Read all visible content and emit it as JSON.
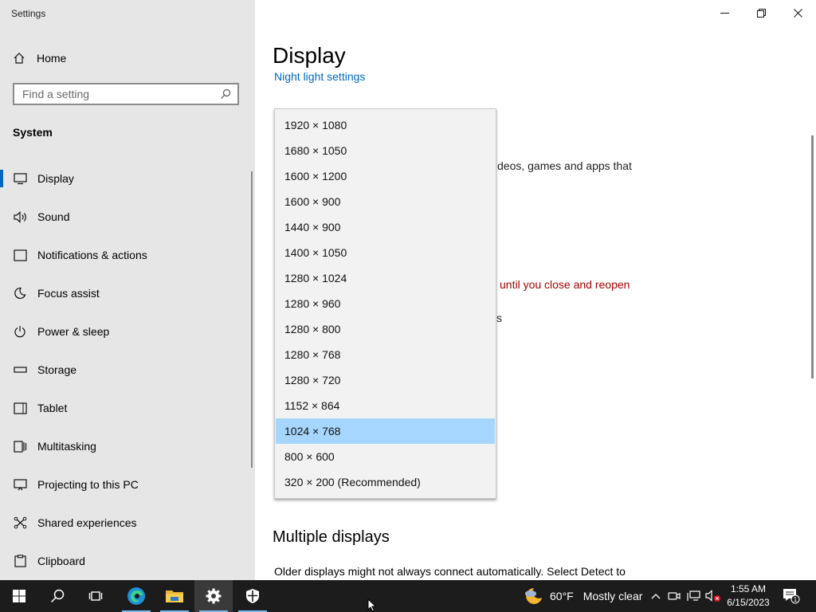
{
  "window": {
    "app_title": "Settings"
  },
  "sidebar": {
    "home_label": "Home",
    "search_placeholder": "Find a setting",
    "section_label": "System",
    "items": [
      {
        "label": "Display",
        "icon": "monitor-icon"
      },
      {
        "label": "Sound",
        "icon": "speaker-icon"
      },
      {
        "label": "Notifications & actions",
        "icon": "notification-icon"
      },
      {
        "label": "Focus assist",
        "icon": "moon-icon"
      },
      {
        "label": "Power & sleep",
        "icon": "power-icon"
      },
      {
        "label": "Storage",
        "icon": "storage-icon"
      },
      {
        "label": "Tablet",
        "icon": "tablet-icon"
      },
      {
        "label": "Multitasking",
        "icon": "multitasking-icon"
      },
      {
        "label": "Projecting to this PC",
        "icon": "projecting-icon"
      },
      {
        "label": "Shared experiences",
        "icon": "shared-experiences-icon"
      },
      {
        "label": "Clipboard",
        "icon": "clipboard-icon"
      }
    ]
  },
  "main": {
    "title": "Display",
    "night_light_link": "Night light settings",
    "partial_text_1": "deos, games and apps that",
    "partial_text_2": "until you close and reopen",
    "partial_text_3": "s",
    "multiple_displays_heading": "Multiple displays",
    "multiple_displays_text": "Older displays might not always connect automatically. Select Detect to"
  },
  "resolution_dropdown": {
    "options": [
      "1920 × 1080",
      "1680 × 1050",
      "1600 × 1200",
      "1600 × 900",
      "1440 × 900",
      "1400 × 1050",
      "1280 × 1024",
      "1280 × 960",
      "1280 × 800",
      "1280 × 768",
      "1280 × 720",
      "1152 × 864",
      "1024 × 768",
      "800 × 600",
      "320 × 200 (Recommended)"
    ],
    "selected": "1024 × 768"
  },
  "taskbar": {
    "weather_temp": "60°F",
    "weather_condition": "Mostly clear",
    "time": "1:55 AM",
    "date": "6/15/2023",
    "notification_count": "1"
  },
  "colors": {
    "accent": "#0067c0",
    "selected_option": "#a6d6fd",
    "warning_text": "#a80000",
    "taskbar": "#1c1c1c"
  }
}
